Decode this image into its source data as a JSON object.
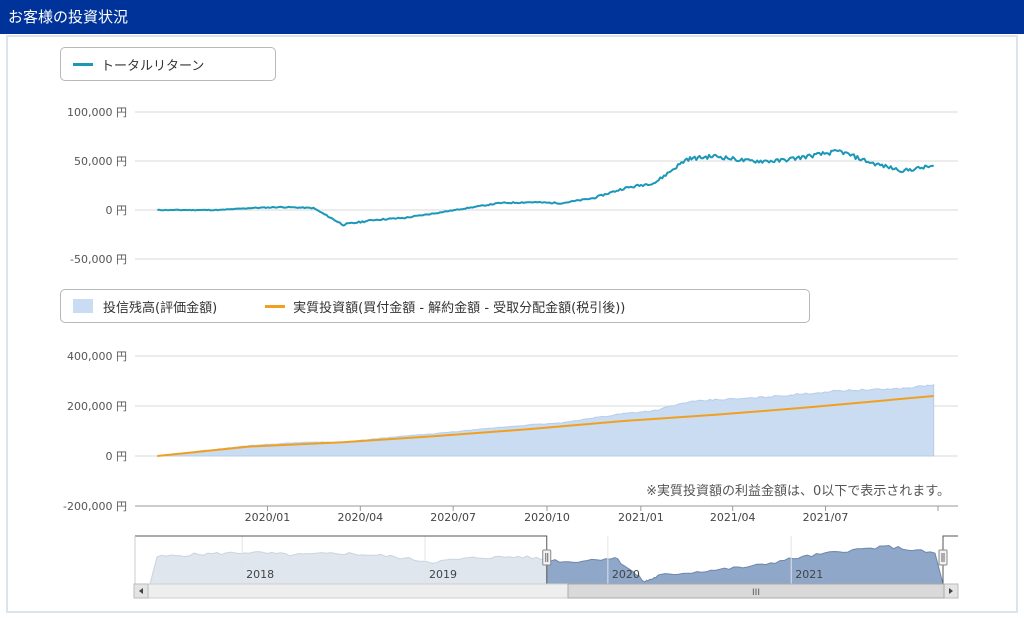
{
  "page": {
    "title": "お客様の投資状況",
    "note": "※実質投資額の利益金額は、0以下で表示されます。"
  },
  "colors": {
    "header": "#003399",
    "return_line": "#1b97b8",
    "balance_area": "#c9dcf2",
    "invest_line": "#f0a020",
    "navigator_fill": "#8fa7c8",
    "navigator_shadow": "#dfe6ee"
  },
  "chart_data": [
    {
      "type": "line",
      "legend": [
        "トータルリターン"
      ],
      "y_ticks": [
        "100,000 円",
        "50,000 円",
        "0 円",
        "-50,000 円"
      ],
      "ylim": [
        -50000,
        100000
      ],
      "x_range": [
        "2019-09-01",
        "2021-10-31"
      ],
      "grid": true,
      "series": [
        {
          "name": "トータルリターン",
          "x": [
            "2019-09",
            "2019-10",
            "2019-11",
            "2019-12",
            "2020-01",
            "2020-02",
            "2020-03",
            "2020-04",
            "2020-05",
            "2020-06",
            "2020-07",
            "2020-08",
            "2020-09",
            "2020-10",
            "2020-11",
            "2020-12",
            "2021-01",
            "2021-02",
            "2021-03",
            "2021-04",
            "2021-05",
            "2021-06",
            "2021-07",
            "2021-08",
            "2021-09",
            "2021-10"
          ],
          "values": [
            0,
            0,
            0,
            2000,
            3000,
            2000,
            -15000,
            -10000,
            -8000,
            -3000,
            2000,
            7000,
            8000,
            7000,
            12000,
            22000,
            28000,
            52000,
            55000,
            50000,
            50000,
            55000,
            60000,
            48000,
            40000,
            45000
          ]
        }
      ]
    },
    {
      "type": "area",
      "legend": [
        "投信残高(評価金額)",
        "実質投資額(買付金額 - 解約金額 - 受取分配金額(税引後))"
      ],
      "y_ticks": [
        "400,000 円",
        "200,000 円",
        "0 円",
        "-200,000 円"
      ],
      "ylim": [
        -200000,
        400000
      ],
      "x_ticks": [
        "2020/01",
        "2020/04",
        "2020/07",
        "2020/10",
        "2021/01",
        "2021/04",
        "2021/07"
      ],
      "x_range": [
        "2019-09-01",
        "2021-10-31"
      ],
      "grid": true,
      "series": [
        {
          "name": "投信残高(評価金額)",
          "x": [
            "2019-09",
            "2019-10",
            "2019-11",
            "2019-12",
            "2020-01",
            "2020-02",
            "2020-03",
            "2020-04",
            "2020-05",
            "2020-06",
            "2020-07",
            "2020-08",
            "2020-09",
            "2020-10",
            "2020-11",
            "2020-12",
            "2021-01",
            "2021-02",
            "2021-03",
            "2021-04",
            "2021-05",
            "2021-06",
            "2021-07",
            "2021-08",
            "2021-09",
            "2021-10"
          ],
          "values": [
            0,
            15000,
            28000,
            42000,
            50000,
            56000,
            55000,
            68000,
            80000,
            90000,
            102000,
            114000,
            125000,
            132000,
            152000,
            170000,
            182000,
            215000,
            225000,
            230000,
            240000,
            250000,
            262000,
            265000,
            270000,
            285000
          ]
        },
        {
          "name": "実質投資額(買付金額 - 解約金額 - 受取分配金額(税引後))",
          "x": [
            "2019-09",
            "2019-12",
            "2020-03",
            "2020-06",
            "2020-09",
            "2020-12",
            "2021-03",
            "2021-06",
            "2021-10"
          ],
          "values": [
            0,
            38000,
            55000,
            80000,
            108000,
            140000,
            165000,
            195000,
            240000
          ]
        }
      ]
    },
    {
      "type": "area",
      "role": "navigator",
      "x_ticks": [
        "2018",
        "2019",
        "2020",
        "2021"
      ],
      "x_range": [
        "2017-07-01",
        "2021-10-31"
      ],
      "selected_range": [
        "2019-09-01",
        "2021-10-31"
      ],
      "series": [
        {
          "x": [
            "2017-07",
            "2017-10",
            "2018-01",
            "2018-04",
            "2018-07",
            "2018-10",
            "2019-01",
            "2019-04",
            "2019-07",
            "2019-10",
            "2020-01",
            "2020-03",
            "2020-04",
            "2020-07",
            "2020-10",
            "2021-01",
            "2021-04",
            "2021-07",
            "2021-10"
          ],
          "values": [
            0.62,
            0.68,
            0.72,
            0.66,
            0.7,
            0.64,
            0.5,
            0.6,
            0.62,
            0.5,
            0.6,
            0.05,
            0.2,
            0.3,
            0.4,
            0.6,
            0.75,
            0.85,
            0.7
          ]
        }
      ]
    }
  ],
  "navigator": {
    "scroll_handle_label": "III"
  }
}
